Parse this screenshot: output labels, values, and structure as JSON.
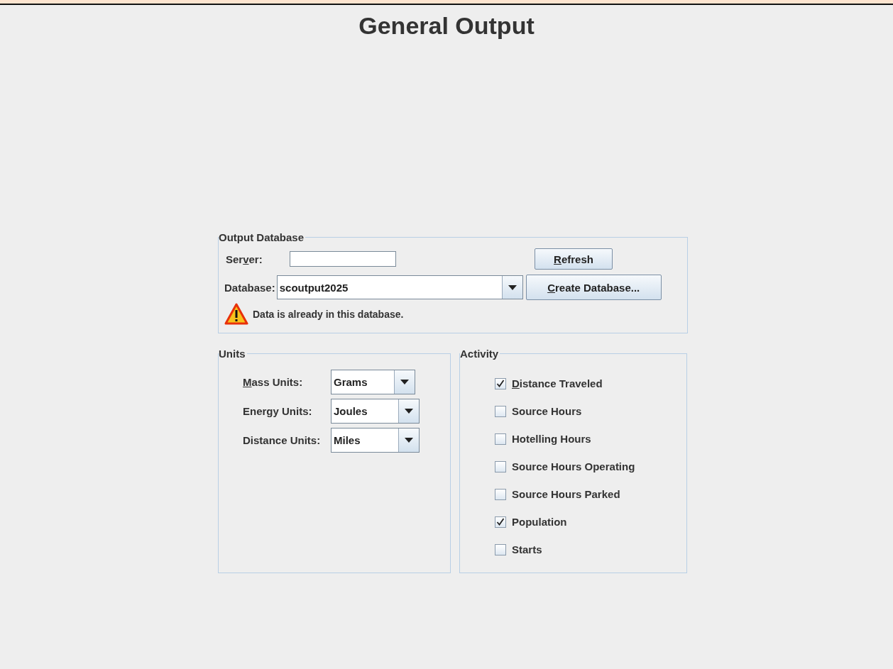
{
  "title": "General Output",
  "output_database": {
    "legend": "Output Database",
    "server": {
      "label": {
        "before": "Ser",
        "mnemonic": "v",
        "after": "er:"
      }
    },
    "refresh_button": {
      "mnemonic": "R",
      "after": "efresh"
    },
    "database": {
      "label": "Database:",
      "value": "scoutput2025"
    },
    "create_button": {
      "mnemonic": "C",
      "after": "reate Database..."
    },
    "warning": "Data is already in this database."
  },
  "units": {
    "legend": "Units",
    "rows": [
      {
        "label": {
          "mnemonic": "M",
          "after": "ass Units:"
        },
        "value": "Grams"
      },
      {
        "label": "Energy Units:",
        "value": "Joules"
      },
      {
        "label": "Distance Units:",
        "value": "Miles"
      }
    ]
  },
  "activity": {
    "legend": "Activity",
    "items": [
      {
        "label": {
          "mnemonic": "D",
          "after": "istance Traveled"
        },
        "checked": true
      },
      {
        "label": "Source Hours",
        "checked": false
      },
      {
        "label": "Hotelling Hours",
        "checked": false
      },
      {
        "label": "Source Hours Operating",
        "checked": false
      },
      {
        "label": "Source Hours Parked",
        "checked": false
      },
      {
        "label": "Population",
        "checked": true
      },
      {
        "label": "Starts",
        "checked": false
      }
    ]
  }
}
